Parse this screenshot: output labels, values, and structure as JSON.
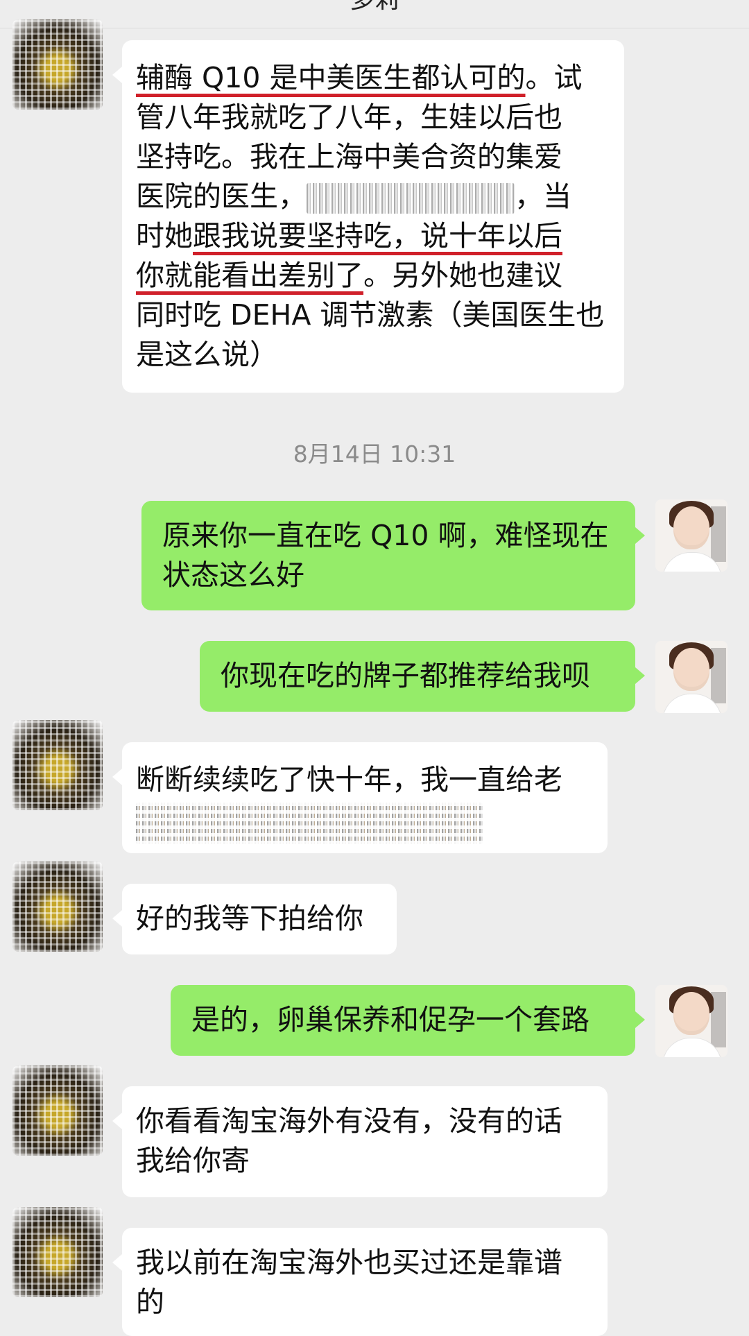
{
  "header": {
    "title": "多莉"
  },
  "messages": [
    {
      "side": "in",
      "lines": [
        [
          "辅酶 Q10 是中美医生都认可的",
          "。试"
        ],
        [
          "管八年我就吃了八年，生娃以后也"
        ],
        [
          "坚持吃。我在上海中美合资的集爱"
        ],
        [
          "医院的医生，",
          "，当"
        ],
        [
          "时她",
          "跟我说要坚持吃，说十年以后"
        ],
        [
          "你就能看出差别了",
          "。另外她也建议"
        ],
        [
          "同时吃 DEHA 调节激素（美国医生也"
        ],
        [
          "是这么说）"
        ]
      ]
    },
    {
      "timestamp": "8月14日 10:31"
    },
    {
      "side": "out",
      "lines": [
        "原来你一直在吃 Q10 啊，难怪现在",
        "状态这么好"
      ]
    },
    {
      "side": "out",
      "lines": [
        "你现在吃的牌子都推荐给我呗"
      ]
    },
    {
      "side": "in",
      "lines": [
        "断断续续吃了快十年，我一直给老"
      ]
    },
    {
      "side": "in",
      "lines": [
        "好的我等下拍给你"
      ]
    },
    {
      "side": "out",
      "lines": [
        "是的，卵巢保养和促孕一个套路"
      ]
    },
    {
      "side": "in",
      "lines": [
        "你看看淘宝海外有没有，没有的话",
        "我给你寄"
      ]
    },
    {
      "side": "in",
      "lines": [
        "我以前在淘宝海外也买过还是靠谱",
        "的"
      ]
    }
  ],
  "colors": {
    "incoming_bubble": "#ffffff",
    "outgoing_bubble": "#95ec69",
    "underline": "#d0202a",
    "background": "#ededed"
  }
}
